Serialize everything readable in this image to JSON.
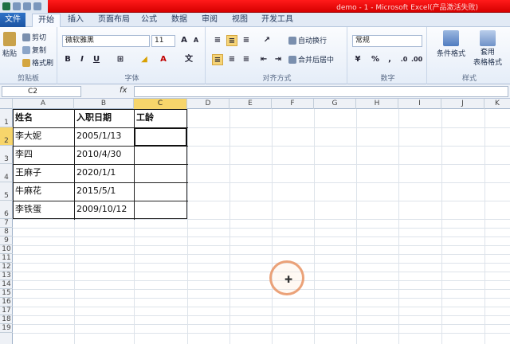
{
  "window": {
    "title": "demo - 1 - Microsoft Excel(产品激活失败)"
  },
  "tabs": [
    "文件",
    "开始",
    "插入",
    "页面布局",
    "公式",
    "数据",
    "审阅",
    "视图",
    "开发工具"
  ],
  "ribbon": {
    "clipboard": {
      "paste": "粘贴",
      "cut": "剪切",
      "copy": "复制",
      "format_painter": "格式刷",
      "label": "剪贴板"
    },
    "font": {
      "name": "微软雅黑",
      "size": "11",
      "bold": "B",
      "italic": "I",
      "underline": "U",
      "label": "字体",
      "grow": "A",
      "shrink": "A",
      "wen": "文",
      "color_a": "A"
    },
    "alignment": {
      "wrap": "自动换行",
      "merge": "合并后居中",
      "label": "对齐方式"
    },
    "number": {
      "format": "常规",
      "percent": "%",
      "comma": ",",
      "label": "数字"
    },
    "styles": {
      "cond_format": "条件格式",
      "table_format_1": "套用",
      "table_format_2": "表格格式",
      "label": "样式"
    }
  },
  "formula_bar": {
    "name_box": "C2",
    "fx": "fx",
    "value": ""
  },
  "columns": [
    "A",
    "B",
    "C",
    "D",
    "E",
    "F",
    "G",
    "H",
    "I",
    "J",
    "K"
  ],
  "rows": [
    "1",
    "2",
    "3",
    "4",
    "5",
    "6",
    "7",
    "8",
    "9",
    "10",
    "11",
    "12",
    "13",
    "14",
    "15",
    "16",
    "17",
    "18",
    "19"
  ],
  "table": {
    "headers": [
      "姓名",
      "入职日期",
      "工龄"
    ],
    "rows": [
      [
        "李大妮",
        "2005/1/13",
        ""
      ],
      [
        "李四",
        "2010/4/30",
        ""
      ],
      [
        "王麻子",
        "2020/1/1",
        ""
      ],
      [
        "牛麻花",
        "2015/5/1",
        ""
      ],
      [
        "李铁蛋",
        "2009/10/12",
        ""
      ]
    ]
  },
  "selected_cell": "C2",
  "colors": {
    "accent": "#1b54a3",
    "titlebar": "#e00000",
    "selected_header": "#f7d56b"
  }
}
